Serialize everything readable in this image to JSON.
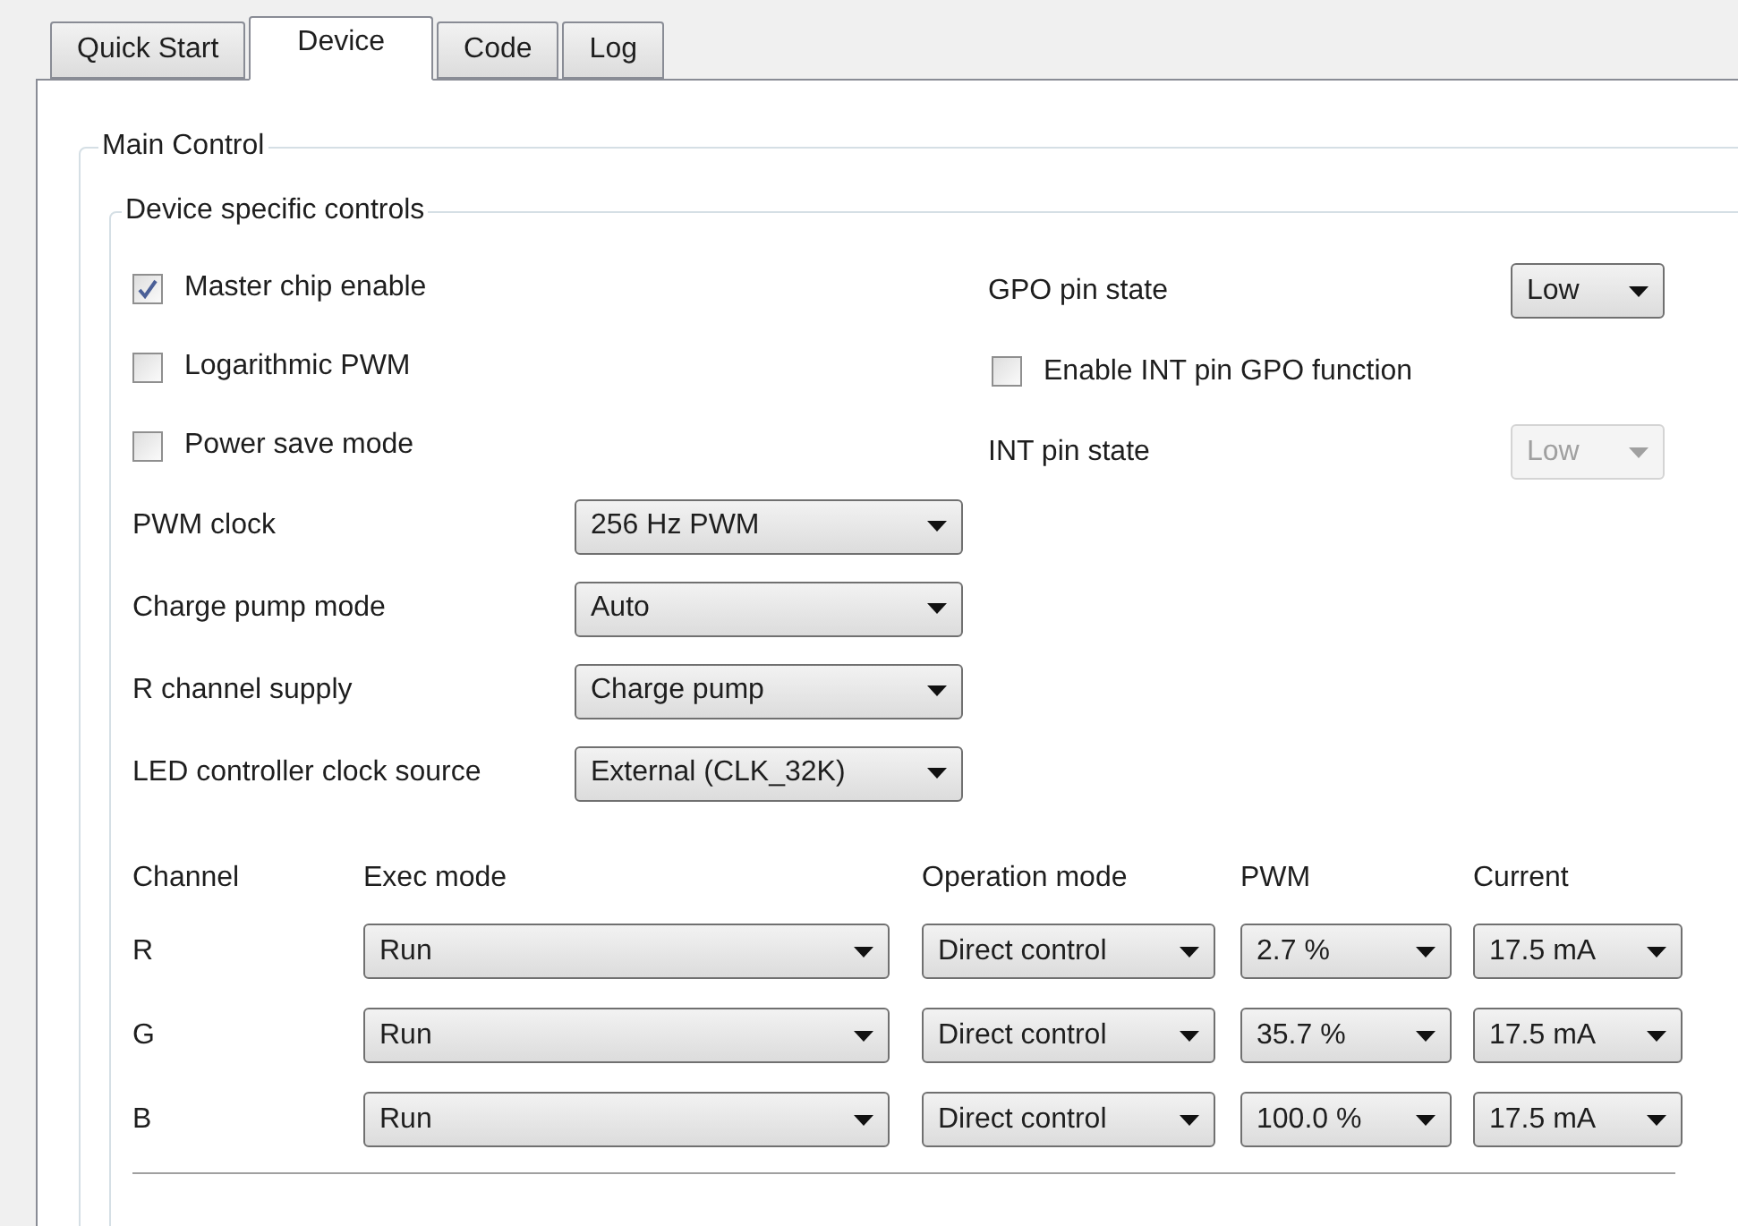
{
  "tabs": [
    {
      "label": "Quick Start",
      "selected": false
    },
    {
      "label": "Device",
      "selected": true
    },
    {
      "label": "Code",
      "selected": false
    },
    {
      "label": "Log",
      "selected": false
    }
  ],
  "main_control": {
    "legend": "Main Control",
    "device_controls": {
      "legend": "Device specific controls",
      "checkboxes": [
        {
          "label": "Master chip enable",
          "checked": true
        },
        {
          "label": "Logarithmic PWM",
          "checked": false
        },
        {
          "label": "Power save mode",
          "checked": false
        }
      ],
      "settings": [
        {
          "label": "PWM clock",
          "value": "256 Hz PWM"
        },
        {
          "label": "Charge pump mode",
          "value": "Auto"
        },
        {
          "label": "R channel supply",
          "value": "Charge pump"
        },
        {
          "label": "LED controller clock source",
          "value": "External (CLK_32K)"
        }
      ],
      "gpo_controls": [
        {
          "kind": "select",
          "label": "GPO pin state",
          "value": "Low",
          "disabled": false
        },
        {
          "kind": "checkbox",
          "label": "Enable INT pin GPO function",
          "checked": false
        },
        {
          "kind": "select",
          "label": "INT pin state",
          "value": "Low",
          "disabled": true
        }
      ],
      "channels": {
        "columns": [
          "Channel",
          "Exec mode",
          "Operation mode",
          "PWM",
          "Current"
        ],
        "rows": [
          {
            "channel": "R",
            "exec_mode": "Run",
            "operation_mode": "Direct control",
            "pwm": "2.7 %",
            "current": "17.5 mA"
          },
          {
            "channel": "G",
            "exec_mode": "Run",
            "operation_mode": "Direct control",
            "pwm": "35.7 %",
            "current": "17.5 mA"
          },
          {
            "channel": "B",
            "exec_mode": "Run",
            "operation_mode": "Direct control",
            "pwm": "100.0 %",
            "current": "17.5 mA"
          }
        ]
      }
    }
  }
}
